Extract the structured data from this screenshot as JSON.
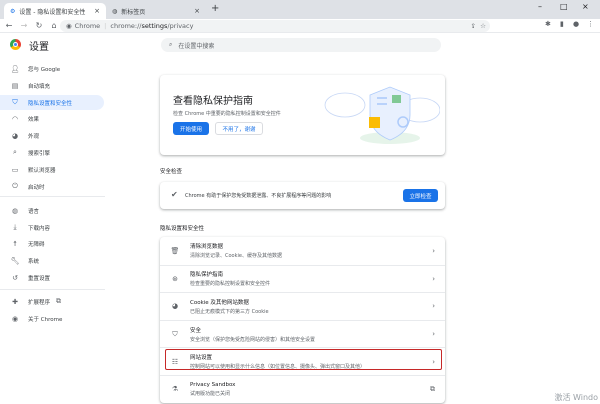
{
  "tabs": [
    {
      "label": "设置 - 隐私设置和安全性",
      "icon": "gear-icon"
    },
    {
      "label": "新标签页",
      "icon": "globe-icon"
    }
  ],
  "toolbar": {
    "site_label": "Chrome",
    "url_prefix": "chrome://",
    "url_bold": "settings",
    "url_suffix": "/privacy"
  },
  "header": {
    "title": "设置",
    "search_placeholder": "在设置中搜索"
  },
  "sidebar": {
    "items": [
      {
        "label": "您与 Google",
        "icon": "person-icon"
      },
      {
        "label": "自动填充",
        "icon": "clipboard-icon"
      },
      {
        "label": "隐私设置和安全性",
        "icon": "shield-icon",
        "active": true
      },
      {
        "label": "效果",
        "icon": "speed-icon"
      },
      {
        "label": "外观",
        "icon": "palette-icon"
      },
      {
        "label": "搜索引擎",
        "icon": "search-icon"
      },
      {
        "label": "默认浏览器",
        "icon": "browser-icon"
      },
      {
        "label": "启动时",
        "icon": "power-icon"
      },
      {
        "label": "语言",
        "icon": "language-icon"
      },
      {
        "label": "下载内容",
        "icon": "download-icon"
      },
      {
        "label": "无障碍",
        "icon": "accessibility-icon"
      },
      {
        "label": "系统",
        "icon": "wrench-icon"
      },
      {
        "label": "重置设置",
        "icon": "reset-icon"
      },
      {
        "label": "扩展程序",
        "icon": "puzzle-icon"
      },
      {
        "label": "关于 Chrome",
        "icon": "chrome-icon"
      }
    ]
  },
  "guide": {
    "title": "查看隐私保护指南",
    "subtitle": "检查 Chrome 中重要的隐私控制设置和安全控件",
    "start": "开始使用",
    "dismiss": "不用了，谢谢"
  },
  "safety": {
    "section": "安全检查",
    "text": "Chrome 有助于保护您免受数据泄露、不良扩展程序等问题的影响",
    "button": "立即检查"
  },
  "privacy": {
    "section": "隐私设置和安全性",
    "rows": [
      {
        "title": "清除浏览数据",
        "desc": "清除浏览记录、Cookie、缓存及其他数据",
        "icon": "trash-icon"
      },
      {
        "title": "隐私保护指南",
        "desc": "检查重要的隐私控制设置和安全控件",
        "icon": "compass-icon"
      },
      {
        "title": "Cookie 及其他网站数据",
        "desc": "已阻止无痕模式下的第三方 Cookie",
        "icon": "cookie-icon"
      },
      {
        "title": "安全",
        "desc": "安全浏览（保护您免受危险网站的侵害）和其他安全设置",
        "icon": "security-shield-icon"
      },
      {
        "title": "网站设置",
        "desc": "控制网站可以使用和显示什么信息（如位置信息、摄像头、弹出式窗口及其他）",
        "icon": "sliders-icon"
      },
      {
        "title": "Privacy Sandbox",
        "desc": "试用版功能已关闭",
        "icon": "flask-icon"
      }
    ]
  },
  "watermark": "激活 Windo"
}
